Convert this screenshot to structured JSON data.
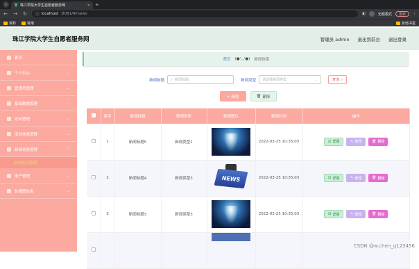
{
  "browser": {
    "tab_title": "珠江学院大学生自愿者服务网",
    "url_host": "localhost",
    "url_rest": ":8081/#/news",
    "incognito_label": "无痕模式",
    "update_label": "更新",
    "bookmarks": [
      "资料",
      "常用"
    ],
    "bookmarks_right": "其他书签"
  },
  "header": {
    "title": "珠江学院大学生自愿者服务网",
    "user_label": "管理员 admin",
    "back_admin": "退出到前台",
    "logout": "退出登录"
  },
  "sidebar": {
    "items": [
      {
        "label": "首页"
      },
      {
        "label": "个人中心"
      },
      {
        "label": "管理员管理"
      },
      {
        "label": "基础数据管理"
      },
      {
        "label": "论坛管理"
      },
      {
        "label": "活动信息管理"
      },
      {
        "label": "新闻信息管理"
      },
      {
        "label": "用户管理"
      },
      {
        "label": "轮播图信息"
      }
    ],
    "sub_active": "新闻信息管理"
  },
  "breadcrumb": {
    "home": "首页",
    "face": "(●'◡'●)",
    "current": "新闻信息"
  },
  "search": {
    "title_label": "新闻标题",
    "title_placeholder": "新闻标题",
    "type_label": "新闻类型",
    "type_placeholder": "请选择新闻类型",
    "query_button": "查询"
  },
  "actions": {
    "add": "新增",
    "delete": "删除"
  },
  "table": {
    "headers": [
      "索引",
      "新闻标题",
      "新闻类型",
      "新闻图片",
      "新闻时间",
      "操作"
    ],
    "rows": [
      {
        "index": "1",
        "title": "新闻标题5",
        "type": "新闻类型1",
        "time": "2022-03-25 10:35:03"
      },
      {
        "index": "2",
        "title": "新闻标题4",
        "type": "新闻类型3",
        "time": "2022-03-25 10:35:03",
        "img_text": "NEWS"
      },
      {
        "index": "3",
        "title": "新闻标题3",
        "type": "新闻类型3",
        "time": "2022-03-25 10:35:03"
      }
    ],
    "op_detail": "详情",
    "op_edit": "修改",
    "op_delete": "删除"
  },
  "watermark": "CSDN @w.chen_q123456"
}
